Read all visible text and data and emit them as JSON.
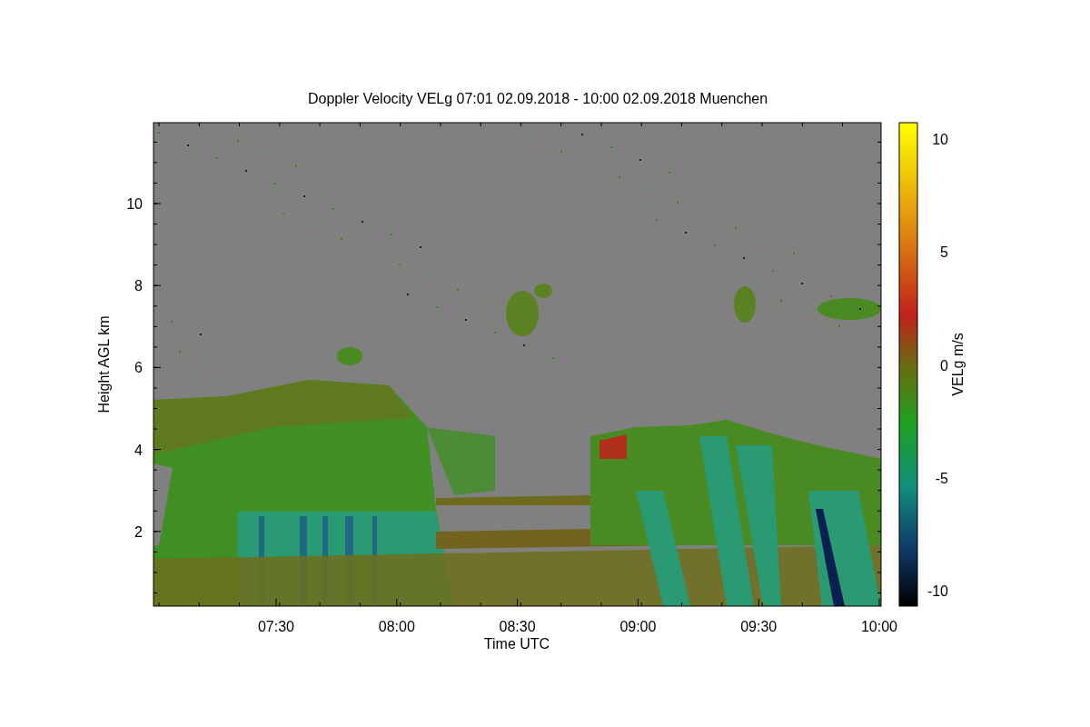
{
  "title": "Doppler Velocity VELg   07:01 02.09.2018 - 10:00 02.09.2018 Muenchen",
  "y_axis": {
    "label": "Height AGL km",
    "ticks": [
      "10",
      "8",
      "6",
      "4",
      "2"
    ]
  },
  "x_axis": {
    "label": "Time UTC",
    "ticks": [
      "07:30",
      "08:00",
      "08:30",
      "09:00",
      "09:30",
      "10:00"
    ]
  },
  "colorbar": {
    "label": "VELg m/s",
    "ticks": [
      "10",
      "5",
      "0",
      "-5",
      "-10"
    ]
  }
}
